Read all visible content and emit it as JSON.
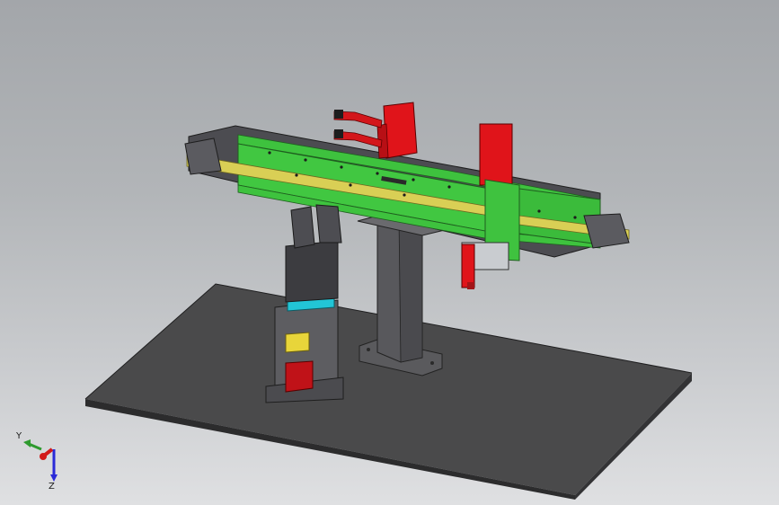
{
  "viewport": {
    "background_top": "#a3a6aa",
    "background_bottom": "#dfe0e2"
  },
  "model": {
    "colors": {
      "base_plate": "#4a4a4a",
      "column": "#5a5a5e",
      "rail_green": "#3ec23e",
      "belt_yellow": "#d9cf55",
      "frame_dark": "#4b4b50",
      "motor_red": "#e0141a",
      "gripper_cyan": "#22c5d6",
      "hardware_yellow": "#e8d53a"
    }
  },
  "triad": {
    "x_label": "",
    "y_label": "Y",
    "z_label": "Z",
    "x_color": "#d21a1a",
    "y_color": "#2e9a2e",
    "z_color": "#2a2ad8"
  }
}
